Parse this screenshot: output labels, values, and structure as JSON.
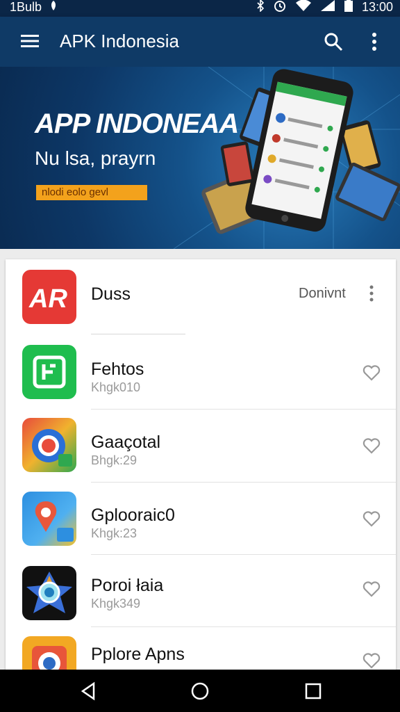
{
  "status_bar": {
    "left_text": "1Bulb",
    "time": "13:00"
  },
  "app_bar": {
    "title": "APK Indonesia",
    "icons": [
      "menu-icon",
      "search-icon",
      "more-vert-icon"
    ]
  },
  "banner": {
    "headline": "APP INDONEAA",
    "subline": "Nu lsa, prayrn",
    "tag": "nlodi eolo gevl"
  },
  "apps": [
    {
      "name": "Duss",
      "action": "Donivnt",
      "icon": "ar-app-icon",
      "color": "#e53935"
    },
    {
      "name": "Fehtos",
      "meta": "Khgk010",
      "icon": "green-app-icon",
      "color": "#1fbd4e"
    },
    {
      "name": "Gaaçotal",
      "meta": "Bhgk:29",
      "icon": "chrome-like-icon",
      "color": "#e84b3c"
    },
    {
      "name": "Gplooraic0",
      "meta": "Khgk:23",
      "icon": "maps-like-icon",
      "color": "#2d8fe0"
    },
    {
      "name": "Poroi łaia",
      "meta": "Khgk349",
      "icon": "camera-lens-icon",
      "color": "#111111"
    },
    {
      "name": "Pplore Apns",
      "meta": "",
      "icon": "orange-app-icon",
      "color": "#f2a823"
    }
  ],
  "colors": {
    "app_bar": "#0f3a66",
    "status_bar": "#0b2647",
    "banner_tag": "#f3a21c"
  }
}
